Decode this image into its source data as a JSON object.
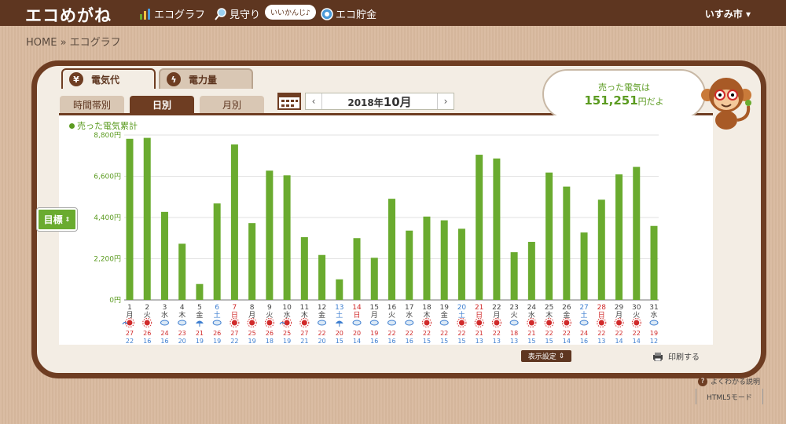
{
  "header": {
    "logo": "エコめがね",
    "nav": [
      {
        "label": "エコグラフ",
        "icon": "graph-icon"
      },
      {
        "label": "見守り",
        "icon": "search-icon"
      },
      {
        "label": "エコ貯金",
        "icon": "coin-icon"
      }
    ],
    "bubble": "いいかんじ♪",
    "user": "いすみ市 ▾"
  },
  "breadcrumb": "HOME » エコグラフ",
  "tabs": [
    {
      "label": "電気代",
      "icon": "yen-icon",
      "active": true
    },
    {
      "label": "電力量",
      "icon": "lightning-icon",
      "active": false
    }
  ],
  "subtabs": [
    {
      "label": "時間帯別",
      "active": false
    },
    {
      "label": "日別",
      "active": true
    },
    {
      "label": "月別",
      "active": false
    }
  ],
  "date": {
    "prefix": "2018年",
    "month": "10月",
    "prev": "‹",
    "next": "›"
  },
  "sold": {
    "line1": "売った電気は",
    "amount": "151,251",
    "suffix": "円だよ"
  },
  "legend": "売った電気累計",
  "target_button": "目標",
  "display_settings": "表示設定",
  "print": "印刷する",
  "help": "よくわかる説明",
  "html5": "HTML5モード",
  "colors": {
    "bar": "#6aab2f",
    "sat": "#3f7fd0",
    "sun": "#d02a2a",
    "brown": "#5e3620"
  },
  "chart_data": {
    "type": "bar",
    "title": "",
    "ylim": [
      0,
      8800
    ],
    "yticks": [
      "0円",
      "2,200円",
      "4,400円",
      "6,600円",
      "8,800円"
    ],
    "categories": [
      "1",
      "2",
      "3",
      "4",
      "5",
      "6",
      "7",
      "8",
      "9",
      "10",
      "11",
      "12",
      "13",
      "14",
      "15",
      "16",
      "17",
      "18",
      "19",
      "20",
      "21",
      "22",
      "23",
      "24",
      "25",
      "26",
      "27",
      "28",
      "29",
      "30",
      "31"
    ],
    "weekdays": [
      "月",
      "火",
      "水",
      "木",
      "金",
      "土",
      "日",
      "月",
      "火",
      "水",
      "木",
      "金",
      "土",
      "日",
      "月",
      "火",
      "水",
      "木",
      "金",
      "土",
      "日",
      "月",
      "火",
      "水",
      "木",
      "金",
      "土",
      "日",
      "月",
      "火",
      "水"
    ],
    "series": [
      {
        "name": "売った電気累計",
        "values": [
          8600,
          8650,
          4700,
          3000,
          850,
          5150,
          8300,
          4100,
          6900,
          6650,
          3350,
          2400,
          1100,
          3300,
          2250,
          5400,
          3700,
          4450,
          4250,
          3800,
          7750,
          7550,
          2550,
          3100,
          6800,
          6050,
          3600,
          5350,
          6700,
          7100,
          3950
        ]
      }
    ],
    "temps_high": [
      27,
      26,
      24,
      23,
      21,
      26,
      27,
      25,
      26,
      25,
      27,
      22,
      20,
      20,
      19,
      22,
      22,
      22,
      22,
      22,
      21,
      22,
      18,
      21,
      22,
      22,
      24,
      22,
      22,
      22,
      19
    ],
    "temps_low": [
      22,
      16,
      16,
      20,
      19,
      19,
      22,
      19,
      18,
      19,
      21,
      20,
      15,
      14,
      16,
      16,
      16,
      15,
      15,
      15,
      13,
      13,
      13,
      15,
      15,
      14,
      16,
      13,
      14,
      14,
      12
    ],
    "weather": [
      "sunny-rain",
      "sunny",
      "cloudy",
      "cloudy",
      "umbrella",
      "cloudy",
      "sunny",
      "sunny",
      "sunny",
      "sunny-rain",
      "sunny",
      "cloudy",
      "umbrella",
      "cloudy",
      "cloudy",
      "cloudy",
      "cloudy",
      "sunny",
      "cloudy",
      "sunny",
      "sunny",
      "sunny",
      "cloudy",
      "sunny",
      "sunny",
      "sunny",
      "cloudy",
      "sunny",
      "sunny",
      "sunny",
      "cloudy"
    ]
  }
}
